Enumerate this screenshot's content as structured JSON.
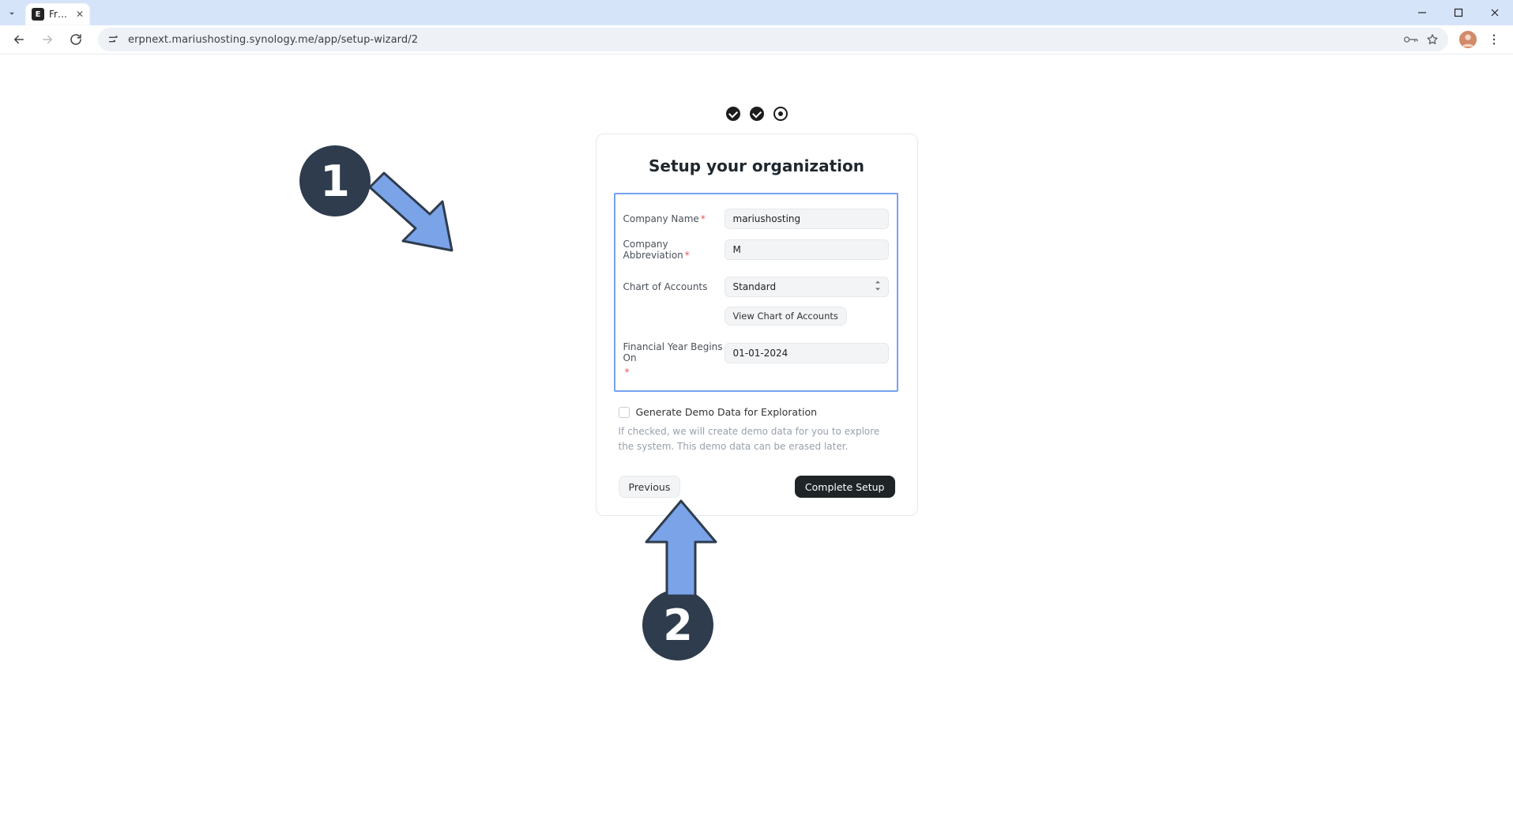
{
  "browser": {
    "tab_title": "Frappe",
    "favicon_letter": "E",
    "url": "erpnext.mariushosting.synology.me/app/setup-wizard/2"
  },
  "wizard": {
    "title": "Setup your organization",
    "fields": {
      "company_name": {
        "label": "Company Name",
        "value": "mariushosting",
        "required": true
      },
      "abbreviation": {
        "label": "Company Abbreviation",
        "value": "M",
        "required": true
      },
      "chart_of_accounts": {
        "label": "Chart of Accounts",
        "value": "Standard"
      },
      "view_coa_button": "View Chart of Accounts",
      "fy_begin": {
        "label": "Financial Year Begins On",
        "value": "01-01-2024",
        "required": true
      }
    },
    "demo": {
      "checkbox_label": "Generate Demo Data for Exploration",
      "help_text": "If checked, we will create demo data for you to explore the system. This demo data can be erased later."
    },
    "buttons": {
      "previous": "Previous",
      "complete": "Complete Setup"
    }
  },
  "annotations": {
    "badge1": "1",
    "badge2": "2"
  }
}
